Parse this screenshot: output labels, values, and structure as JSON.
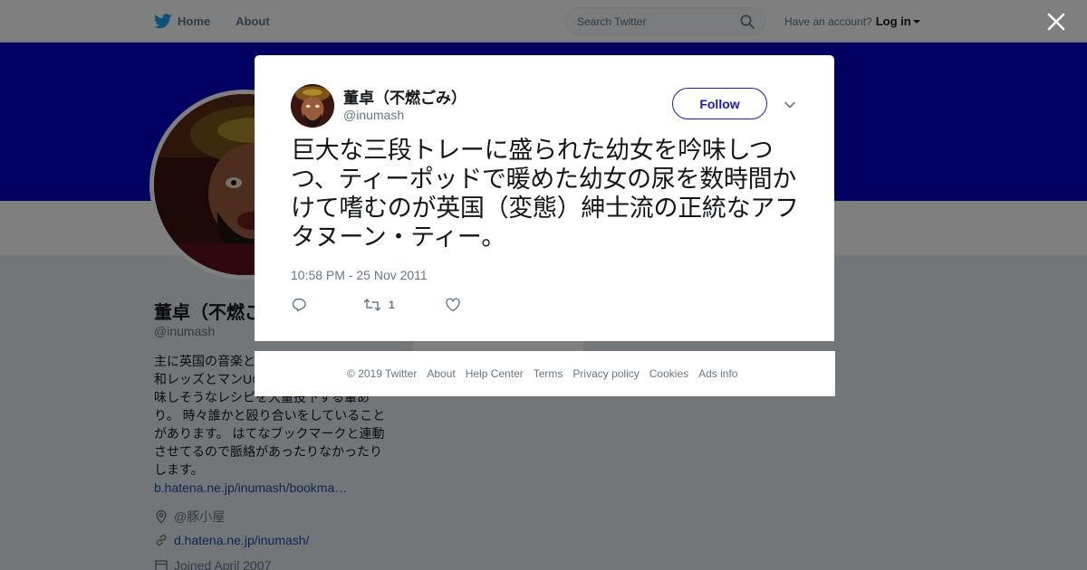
{
  "nav": {
    "home_label": "Home",
    "about_label": "About",
    "search_placeholder": "Search Twitter",
    "have_account": "Have an account?",
    "login_label": "Log in"
  },
  "profile": {
    "name": "董卓（不燃ごみ）",
    "handle": "@inumash",
    "bio_lines": [
      "主に英国の音楽と英国の食事、",
      "和レッズとマンUの話をしつつ、",
      "味しそうなレシピを大量投下する輩あ",
      "り。 時々誰かと殴り合いをしていること",
      "があります。 はてなブックマークと連動",
      "させてるので脈絡があったりなかったり",
      "します。"
    ],
    "bio_link": "b.hatena.ne.jp/inumash/bookma…",
    "location": "@豚小屋",
    "website": "d.hatena.ne.jp/inumash/",
    "joined": "Joined April 2007"
  },
  "tweet": {
    "author_name": "董卓（不燃ごみ）",
    "author_handle": "@inumash",
    "follow_label": "Follow",
    "text": "巨大な三段トレーに盛られた幼女を吟味しつつ、ティーポッドで暖めた幼女の尿を数時間かけて嗜むのが英国（変態）紳士流の正統なアフタヌーン・ティー。",
    "timestamp": "10:58 PM - 25 Nov 2011",
    "retweet_count": "1"
  },
  "footer": {
    "copyright": "© 2019 Twitter",
    "links": [
      "About",
      "Help Center",
      "Terms",
      "Privacy policy",
      "Cookies",
      "Ads info"
    ]
  },
  "colors": {
    "banner": "#0000c4",
    "accent": "#1b1bb0",
    "twitter_blue": "#1da1f2"
  },
  "icons": [
    "twitter-bird-icon",
    "search-icon",
    "close-icon",
    "chevron-down-icon",
    "reply-icon",
    "retweet-icon",
    "like-icon",
    "location-icon",
    "link-icon",
    "calendar-icon"
  ]
}
